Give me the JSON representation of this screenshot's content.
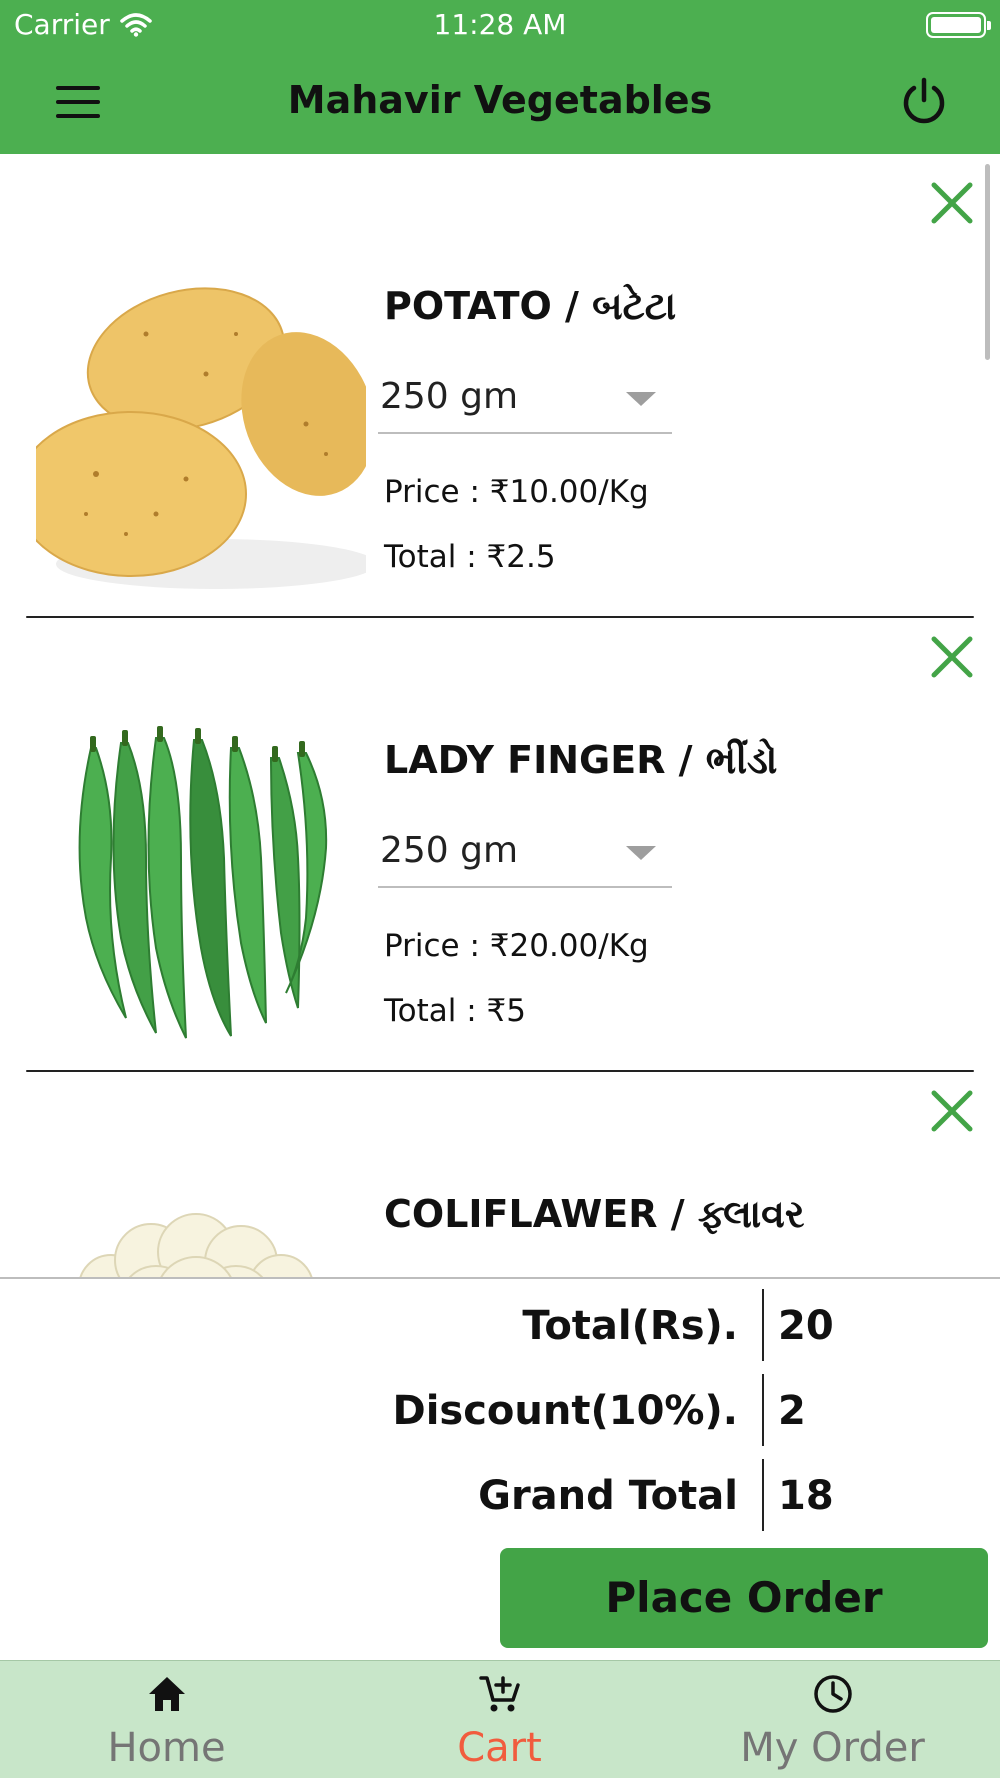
{
  "status_bar": {
    "carrier": "Carrier",
    "time": "11:28 AM"
  },
  "header": {
    "title": "Mahavir Vegetables",
    "menu_icon": "hamburger-menu-icon",
    "logout_icon": "power-icon"
  },
  "colors": {
    "primary": "#4caf50",
    "button": "#43a447",
    "tab_bar_bg": "#c8e6c9",
    "active_tab": "#f15c3e",
    "remove_icon": "#43a447"
  },
  "cart": {
    "items": [
      {
        "name": "POTATO / બટેટા",
        "quantity": "250 gm",
        "price": "Price : ₹10.00/Kg",
        "total": "Total : ₹2.5",
        "image": "potato"
      },
      {
        "name": "LADY FINGER / ભીંડો",
        "quantity": "250 gm",
        "price": "Price : ₹20.00/Kg",
        "total": "Total : ₹5",
        "image": "lady-finger"
      },
      {
        "name": "COLIFLAWER / ફ્લાવર",
        "image": "cauliflower"
      }
    ]
  },
  "summary": {
    "total_label": "Total(Rs).",
    "total_value": "20",
    "discount_label": "Discount(10%).",
    "discount_value": "2",
    "grand_total_label": "Grand Total",
    "grand_total_value": "18"
  },
  "place_order_label": "Place Order",
  "tabs": [
    {
      "label": "Home",
      "icon": "home-icon",
      "active": false
    },
    {
      "label": "Cart",
      "icon": "cart-add-icon",
      "active": true
    },
    {
      "label": "My Order",
      "icon": "clock-icon",
      "active": false
    }
  ]
}
